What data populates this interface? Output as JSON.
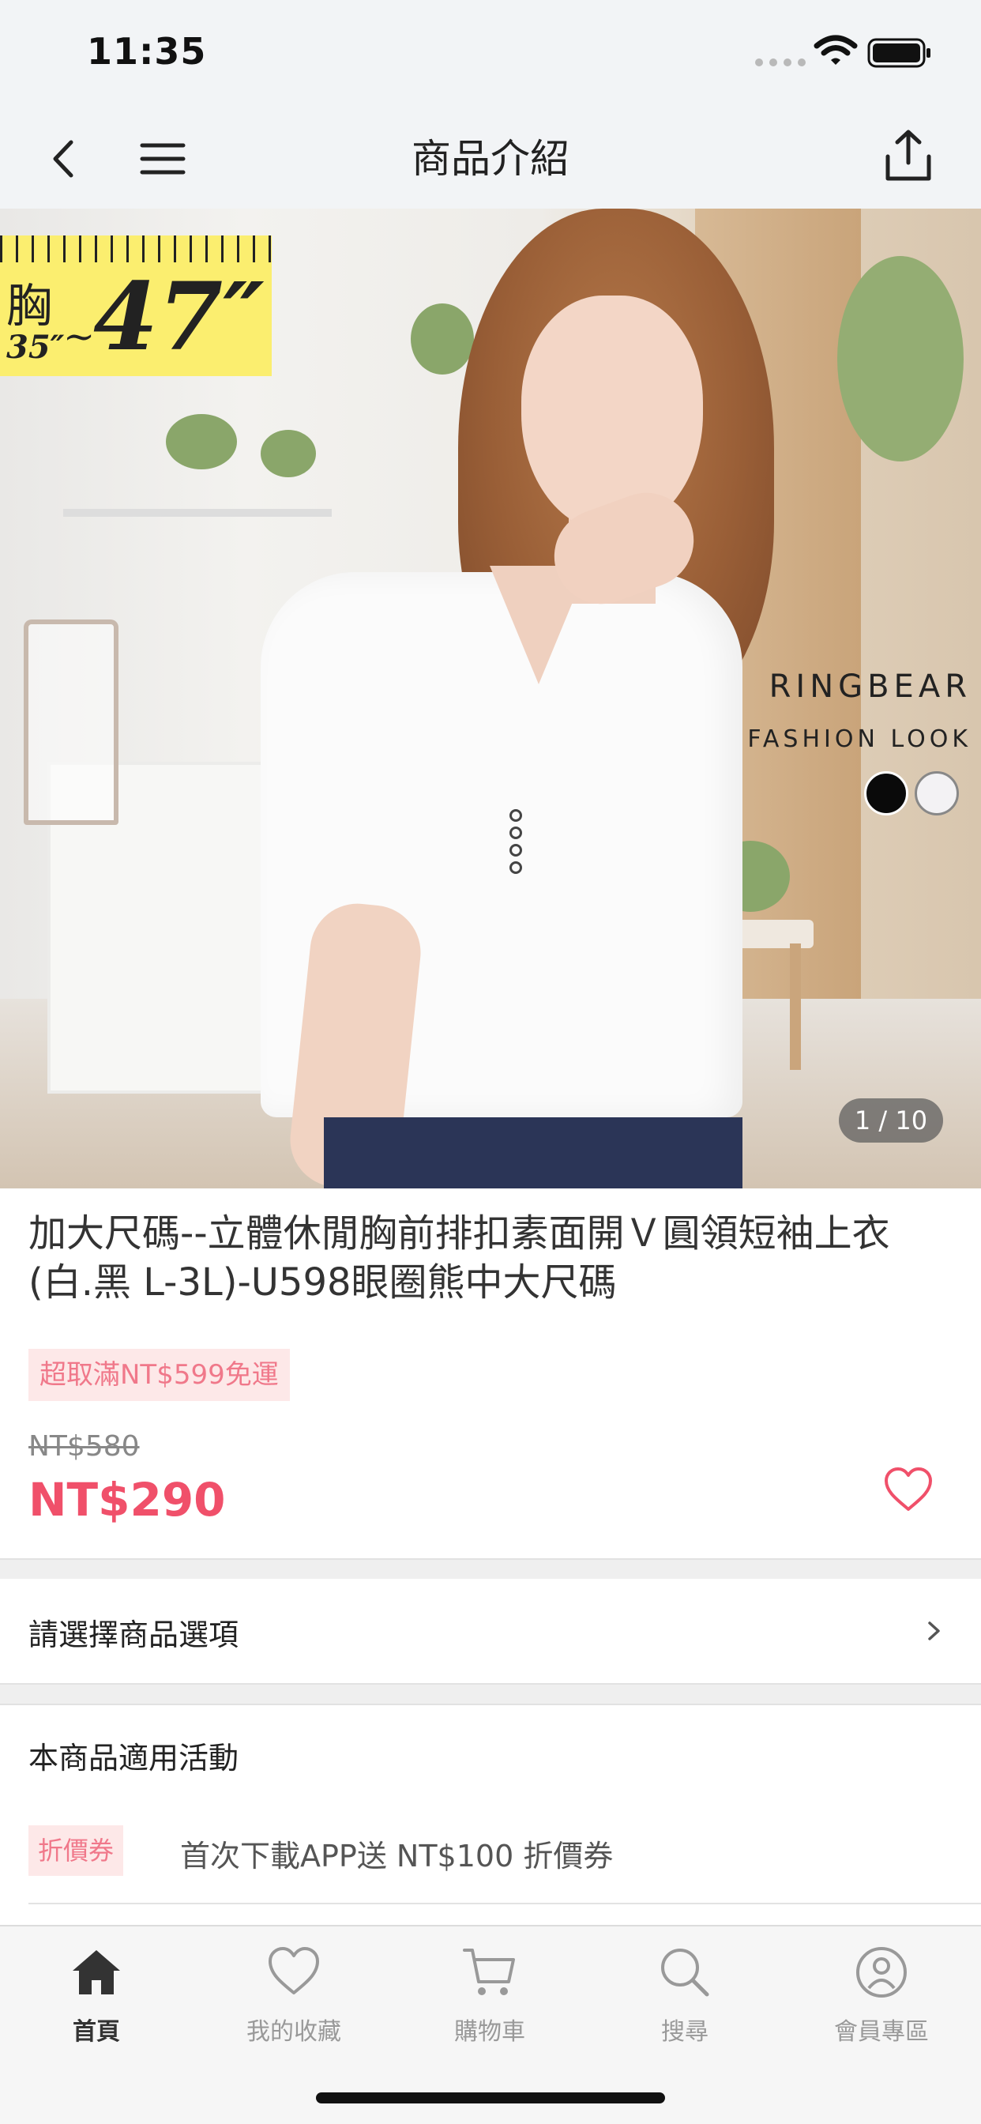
{
  "status_bar": {
    "time": "11:35"
  },
  "nav": {
    "title": "商品介紹",
    "back_icon": "chevron-left-icon",
    "menu_icon": "hamburger-menu-icon",
    "share_icon": "share-icon"
  },
  "hero": {
    "ruler_chest": "胸",
    "ruler_small": "35″",
    "ruler_tilde": "~",
    "ruler_big": "47″",
    "brand_name": "RINGBEAR",
    "brand_sub": "FASHION  LOOK",
    "swatches": [
      "#0a0a0a",
      "#f3f2f4"
    ],
    "counter": "1 / 10"
  },
  "product": {
    "title": "加大尺碼--立體休閒胸前排扣素面開Ｖ圓領短袖上衣(白.黑 L-3L)-U598眼圈熊中大尺碼",
    "shipping_badge": "超取滿NT$599免運",
    "original_price": "NT$580",
    "price": "NT$290",
    "price_color": "#f0506a"
  },
  "options": {
    "label": "請選擇商品選項"
  },
  "promotions": {
    "heading": "本商品適用活動",
    "items": [
      {
        "tag": "折價券",
        "text": "首次下載APP送 NT$100 折價券"
      }
    ]
  },
  "tabbar": {
    "tabs": [
      {
        "label": "首頁",
        "icon": "home-icon",
        "active": true
      },
      {
        "label": "我的收藏",
        "icon": "heart-icon",
        "active": false
      },
      {
        "label": "購物車",
        "icon": "cart-icon",
        "active": false
      },
      {
        "label": "搜尋",
        "icon": "search-icon",
        "active": false
      },
      {
        "label": "會員專區",
        "icon": "user-icon",
        "active": false
      }
    ]
  }
}
